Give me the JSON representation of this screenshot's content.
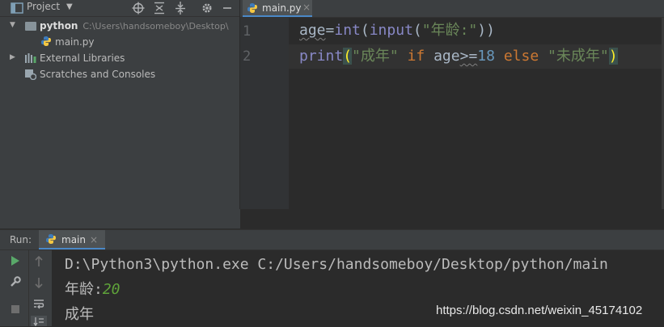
{
  "project_panel": {
    "title": "Project",
    "tree": {
      "root_name": "python",
      "root_path": "C:\\Users\\handsomeboy\\Desktop\\",
      "file": "main.py",
      "external_libraries": "External Libraries",
      "scratches": "Scratches and Consoles"
    }
  },
  "editor": {
    "tab_label": "main.py",
    "tab_close": "×",
    "line_numbers": [
      "1",
      "2"
    ],
    "line1": {
      "var": "age",
      "eq": "=",
      "fn_int": "int",
      "p1": "(",
      "fn_input": "input",
      "p2": "(",
      "str": "\"年龄:\"",
      "p3": "))"
    },
    "line2": {
      "fn_print": "print",
      "p_open": "(",
      "str1": "\"成年\"",
      "kw_if": "if",
      "var": "age",
      "op": ">=",
      "num": "18",
      "kw_else": "else",
      "str2": "\"未成年\"",
      "p_close": ")"
    }
  },
  "run_panel": {
    "label": "Run:",
    "tab_label": "main",
    "tab_close": "×",
    "console": {
      "command": "D:\\Python3\\python.exe C:/Users/handsomeboy/Desktop/python/main",
      "prompt": "年龄:",
      "input_value": "20",
      "output": "成年"
    }
  },
  "watermark": "https://blog.csdn.net/weixin_45174102",
  "colors": {
    "keyword": "#cc7832",
    "string": "#6a8759",
    "number": "#6897bb",
    "builtin": "#8888c6",
    "input_echo": "#5fa33a",
    "run_green": "#59a869"
  }
}
